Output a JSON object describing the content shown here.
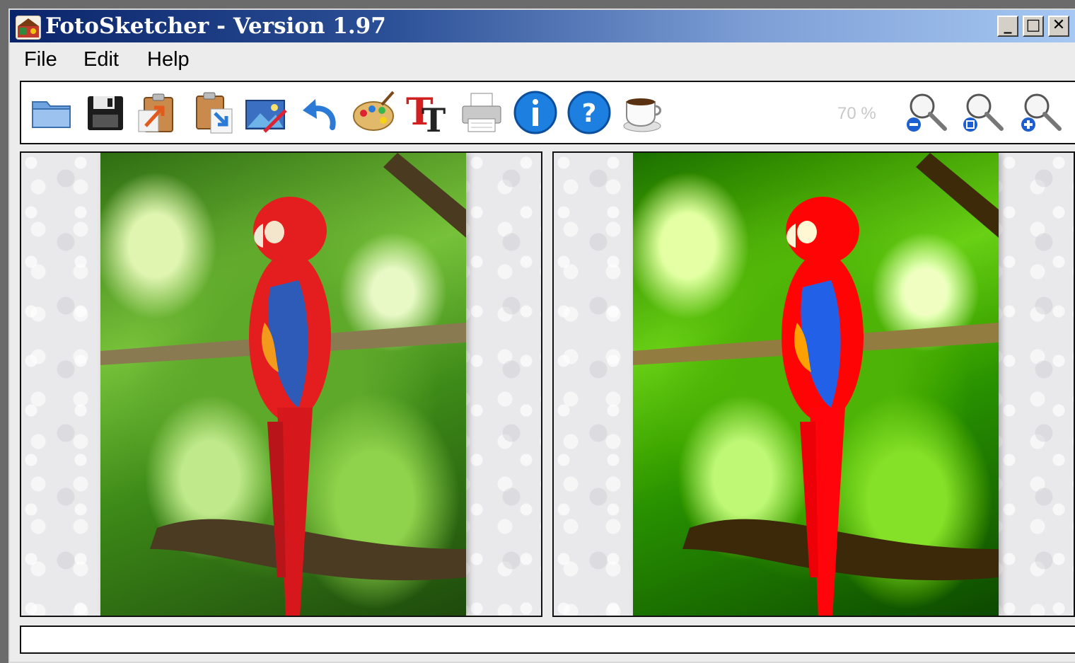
{
  "window": {
    "title": "FotoSketcher - Version 1.97",
    "minimize_label": "_",
    "maximize_label": "□",
    "close_label": "✕"
  },
  "menu": {
    "items": [
      {
        "label": "File"
      },
      {
        "label": "Edit"
      },
      {
        "label": "Help"
      }
    ]
  },
  "toolbar": {
    "tools": [
      {
        "icon": "folder-open-icon"
      },
      {
        "icon": "floppy-save-icon"
      },
      {
        "icon": "clipboard-export-icon"
      },
      {
        "icon": "clipboard-paste-icon"
      },
      {
        "icon": "image-edit-icon"
      },
      {
        "icon": "undo-arrow-icon"
      },
      {
        "icon": "paint-palette-icon"
      },
      {
        "icon": "text-tool-icon"
      },
      {
        "icon": "printer-icon"
      },
      {
        "icon": "info-icon"
      },
      {
        "icon": "help-icon"
      },
      {
        "icon": "coffee-cup-icon"
      }
    ],
    "zoom_level": "70 %",
    "zoom_tools": [
      {
        "icon": "zoom-out-icon"
      },
      {
        "icon": "zoom-fit-icon"
      },
      {
        "icon": "zoom-in-icon"
      }
    ]
  },
  "panes": {
    "original": {
      "subject": "scarlet macaw on branch in jungle"
    },
    "result": {
      "subject": "painted scarlet macaw on branch in jungle"
    }
  },
  "status": {
    "text": ""
  },
  "colors": {
    "title_gradient_start": "#0a246a",
    "title_gradient_end": "#a6c8f2",
    "macaw_red": "#e41e1e",
    "wing_blue": "#2e5ab8"
  }
}
